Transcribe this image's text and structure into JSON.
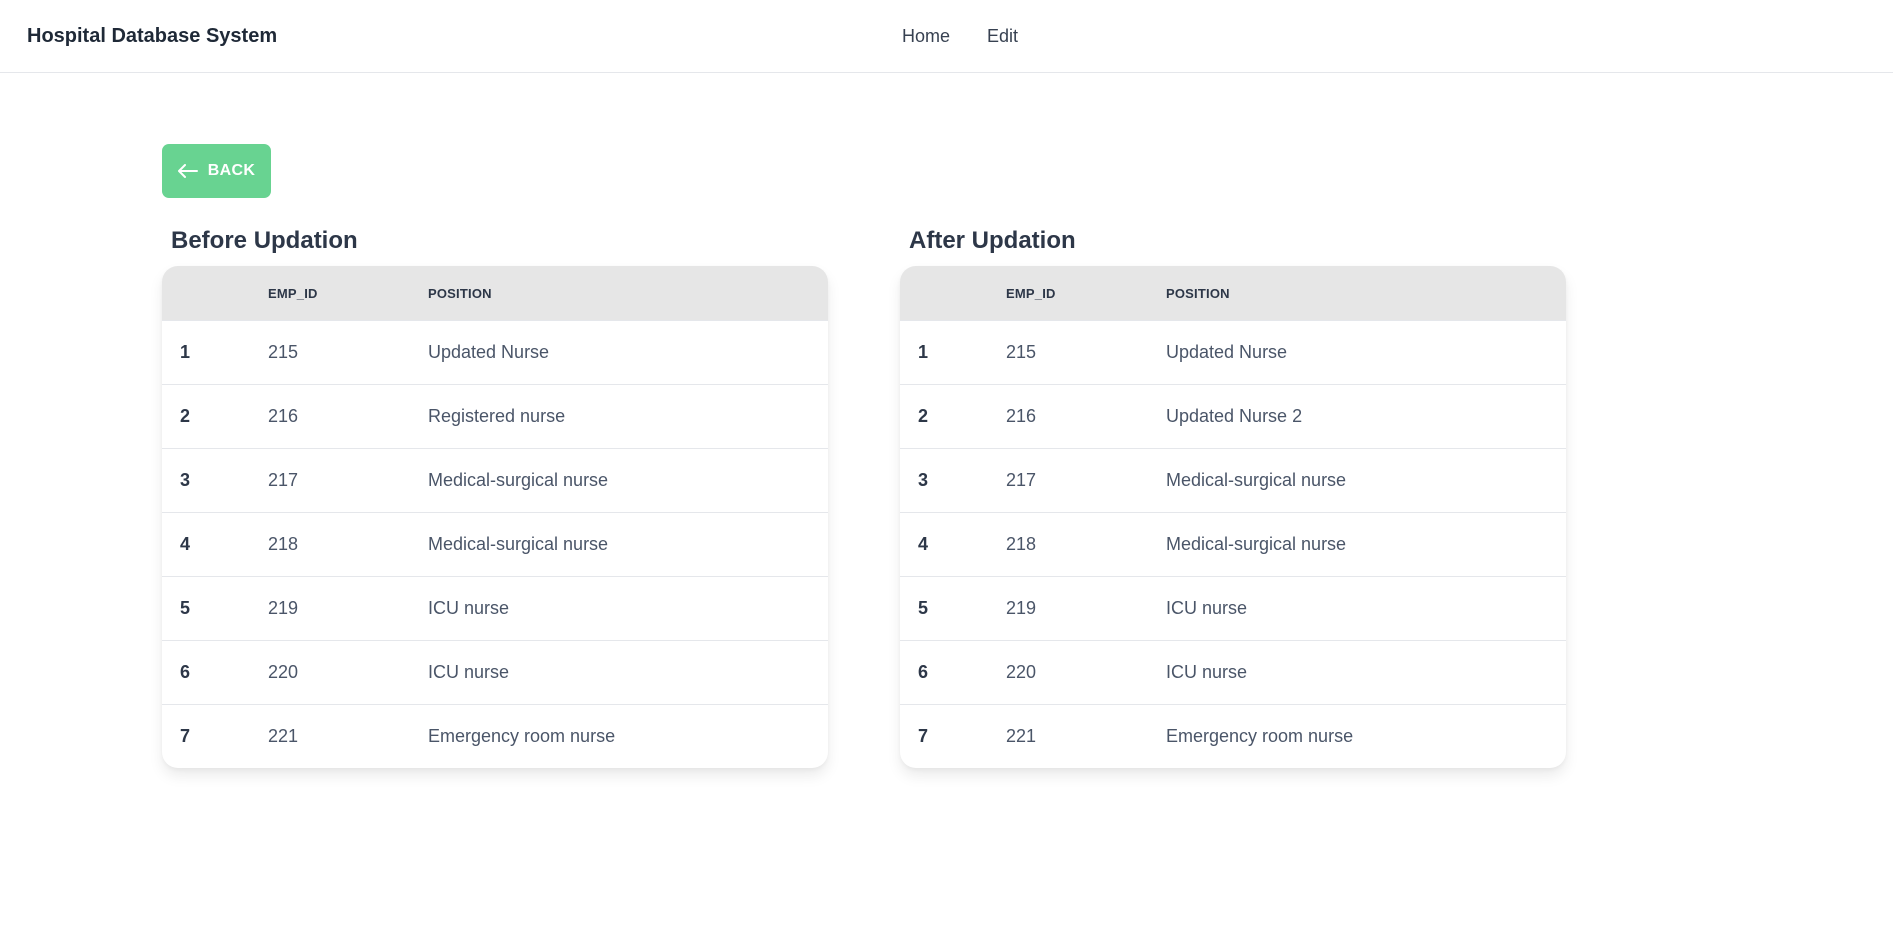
{
  "navbar": {
    "brand": "Hospital Database System",
    "links": [
      "Home",
      "Edit"
    ]
  },
  "back_button": {
    "label": "BACK",
    "icon": "arrow-left-icon",
    "color": "#68d391"
  },
  "before": {
    "title": "Before Updation",
    "headers": [
      "",
      "EMP_ID",
      "POSITION"
    ],
    "rows": [
      {
        "idx": "1",
        "emp_id": "215",
        "position": "Updated Nurse"
      },
      {
        "idx": "2",
        "emp_id": "216",
        "position": "Registered nurse"
      },
      {
        "idx": "3",
        "emp_id": "217",
        "position": "Medical-surgical nurse"
      },
      {
        "idx": "4",
        "emp_id": "218",
        "position": "Medical-surgical nurse"
      },
      {
        "idx": "5",
        "emp_id": "219",
        "position": "ICU nurse"
      },
      {
        "idx": "6",
        "emp_id": "220",
        "position": "ICU nurse"
      },
      {
        "idx": "7",
        "emp_id": "221",
        "position": "Emergency room nurse"
      }
    ]
  },
  "after": {
    "title": "After Updation",
    "headers": [
      "",
      "EMP_ID",
      "POSITION"
    ],
    "rows": [
      {
        "idx": "1",
        "emp_id": "215",
        "position": "Updated Nurse"
      },
      {
        "idx": "2",
        "emp_id": "216",
        "position": "Updated Nurse 2"
      },
      {
        "idx": "3",
        "emp_id": "217",
        "position": "Medical-surgical nurse"
      },
      {
        "idx": "4",
        "emp_id": "218",
        "position": "Medical-surgical nurse"
      },
      {
        "idx": "5",
        "emp_id": "219",
        "position": "ICU nurse"
      },
      {
        "idx": "6",
        "emp_id": "220",
        "position": "ICU nurse"
      },
      {
        "idx": "7",
        "emp_id": "221",
        "position": "Emergency room nurse"
      }
    ]
  }
}
